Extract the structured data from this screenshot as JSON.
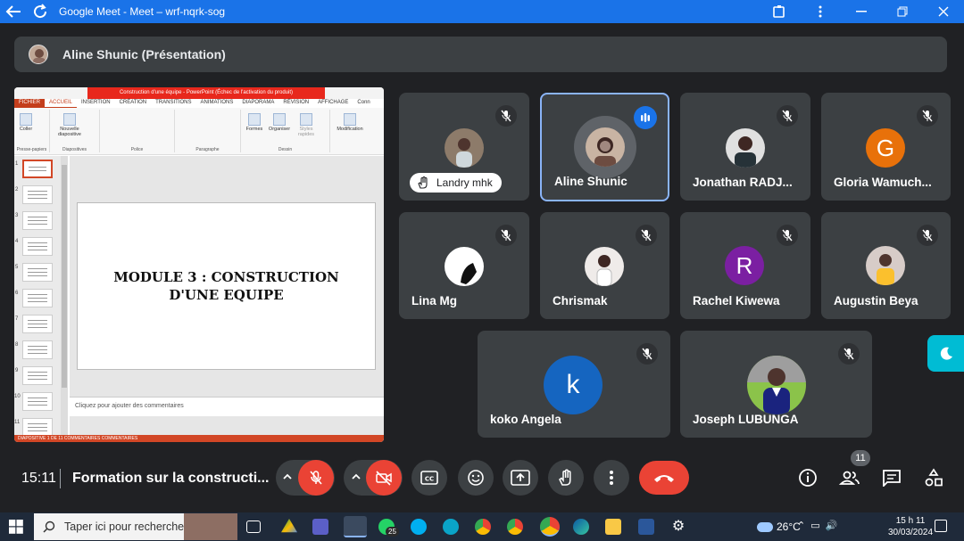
{
  "window": {
    "title": "Google Meet - Meet – wrf-nqrk-sog"
  },
  "presenter": {
    "name": "Aline Shunic (Présentation)"
  },
  "powerpoint": {
    "window_title": "Construction d'une équipe - PowerPoint (Échec de l'activation du produit)",
    "tabs": [
      "FICHIER",
      "ACCUEIL",
      "INSERTION",
      "CRÉATION",
      "TRANSITIONS",
      "ANIMATIONS",
      "DIAPORAMA",
      "RÉVISION",
      "AFFICHAGE",
      "Conn"
    ],
    "ribbon": {
      "coller": "Coller",
      "nouvelle": "Nouvelle diapositive",
      "formes": "Formes",
      "organiser": "Organiser",
      "styles": "Styles rapides",
      "modification": "Modification",
      "groups": [
        "Presse-papiers",
        "Diapositives",
        "Police",
        "Paragraphe",
        "Dessin"
      ]
    },
    "slide_numbers": [
      "1",
      "2",
      "3",
      "4",
      "5",
      "6",
      "7",
      "8",
      "9",
      "10",
      "11"
    ],
    "slide_title_line1": "MODULE 3 : CONSTRUCTION",
    "slide_title_line2": "D'UNE EQUIPE",
    "notes_placeholder": "Cliquez pour ajouter des commentaires",
    "status": "DIAPOSITIVE 1 DE 11     COMMENTAIRES     COMMENTAIRES"
  },
  "participants": [
    {
      "name": "Landry mhk",
      "muted": true
    },
    {
      "name": "Aline Shunic",
      "speaking": true
    },
    {
      "name": "Jonathan RADJ...",
      "muted": true
    },
    {
      "name": "Gloria Wamuch...",
      "initial": "G",
      "color": "#e8710a",
      "muted": true
    },
    {
      "name": "Lina Mg",
      "muted": true
    },
    {
      "name": "Chrismak",
      "muted": true
    },
    {
      "name": "Rachel Kiwewa",
      "initial": "R",
      "color": "#7b1fa2",
      "muted": true
    },
    {
      "name": "Augustin Beya",
      "muted": true
    },
    {
      "name": "koko Angela",
      "initial": "k",
      "color": "#1565c0",
      "muted": true
    },
    {
      "name": "Joseph LUBUNGA",
      "muted": true
    }
  ],
  "bottom": {
    "time": "15:11",
    "meeting_title": "Formation sur la constructi...",
    "participant_count": "11"
  },
  "taskbar": {
    "search_placeholder": "Taper ici pour rechercher",
    "weather": "26°C",
    "clock_time": "15 h 11",
    "clock_date": "30/03/2024",
    "whatsapp_badge": "25"
  }
}
